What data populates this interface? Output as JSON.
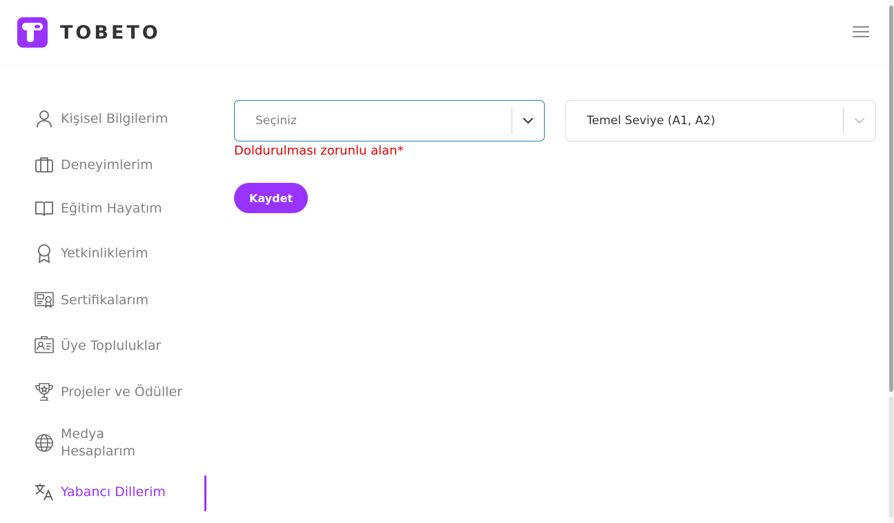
{
  "brand": {
    "name": "TOBETO",
    "accent": "#9933ff"
  },
  "header": {
    "menu_icon": "hamburger-menu-icon"
  },
  "sidebar": {
    "items": [
      {
        "label": "Kişisel Bilgilerim",
        "icon": "user-icon"
      },
      {
        "label": "Deneyimlerim",
        "icon": "briefcase-icon"
      },
      {
        "label": "Eğitim Hayatım",
        "icon": "book-icon"
      },
      {
        "label": "Yetkinliklerim",
        "icon": "award-icon"
      },
      {
        "label": "Sertifikalarım",
        "icon": "certificate-icon"
      },
      {
        "label": "Üye Topluluklar",
        "icon": "id-card-icon"
      },
      {
        "label": "Projeler ve Ödüller",
        "icon": "trophy-icon"
      },
      {
        "label": "Medya Hesaplarım",
        "icon": "globe-icon"
      },
      {
        "label": "Yabancı Dillerim",
        "icon": "translate-icon"
      }
    ],
    "active_item": "Yabancı Dillerim"
  },
  "form": {
    "language_select": {
      "placeholder": "Seçiniz"
    },
    "level_select": {
      "value": "Temel Seviye (A1, A2)"
    },
    "error": "Doldurulması zorunlu alan*",
    "save_label": "Kaydet",
    "error_color": "#e00000"
  }
}
